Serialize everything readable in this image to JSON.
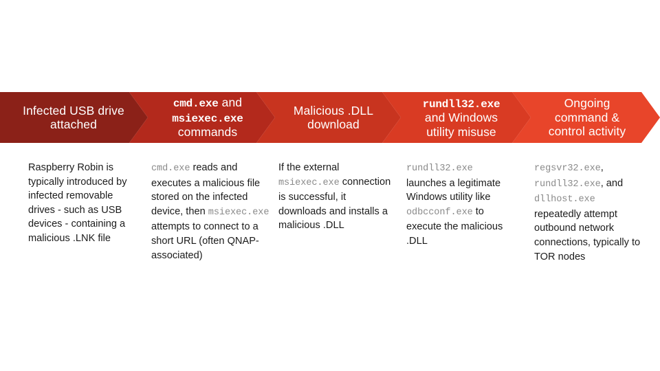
{
  "banner": {
    "aria": "Raspberry Robin attack chain",
    "segments": [
      {
        "id": "infected-usb-drive-attached",
        "color": "#8B2118",
        "lines": [
          {
            "text": "Infected USB drive",
            "mono": false
          },
          {
            "text": "attached",
            "mono": false
          }
        ]
      },
      {
        "id": "cmd-exe-and-msiexec-exe-commands",
        "color": "#B3291C",
        "lines": [
          {
            "text": "cmd.exe",
            "mono": true,
            "suffix": " and"
          },
          {
            "text": "msiexec.exe",
            "mono": true
          },
          {
            "text": "commands",
            "mono": false
          }
        ]
      },
      {
        "id": "malicious-dll-download",
        "color": "#C8341F",
        "lines": [
          {
            "text": "Malicious .DLL",
            "mono": false
          },
          {
            "text": "download",
            "mono": false
          }
        ]
      },
      {
        "id": "rundll32-exe-and-windows-utility-misuse",
        "color": "#D93B23",
        "lines": [
          {
            "text": "rundll32.exe",
            "mono": true
          },
          {
            "text": "and Windows",
            "mono": false
          },
          {
            "text": "utility misuse",
            "mono": false
          }
        ]
      },
      {
        "id": "ongoing-command-and-control-activity",
        "color": "#E8452A",
        "lines": [
          {
            "text": "Ongoing",
            "mono": false
          },
          {
            "text": "command &",
            "mono": false
          },
          {
            "text": "control activity",
            "mono": false
          }
        ]
      }
    ]
  },
  "columns": [
    {
      "id": "stage-1-description",
      "runs": [
        {
          "text": "Raspberry Robin is typically introduced by infected removable drives - such as USB devices - containing a malicious .LNK file",
          "mono": false
        }
      ]
    },
    {
      "id": "stage-2-description",
      "runs": [
        {
          "text": "cmd.exe",
          "mono": true
        },
        {
          "text": " reads and executes a malicious file stored on the infected device, then ",
          "mono": false
        },
        {
          "text": "msiexec.exe",
          "mono": true
        },
        {
          "text": " attempts to connect to a short URL (often QNAP-associated)",
          "mono": false
        }
      ]
    },
    {
      "id": "stage-3-description",
      "runs": [
        {
          "text": "If the external ",
          "mono": false
        },
        {
          "text": "msiexec.exe",
          "mono": true
        },
        {
          "text": " connection is successful, it downloads and installs a malicious .DLL",
          "mono": false
        }
      ]
    },
    {
      "id": "stage-4-description",
      "runs": [
        {
          "text": "rundll32.exe",
          "mono": true
        },
        {
          "text": " launches a legitimate Windows utility like ",
          "mono": false
        },
        {
          "text": "odbcconf.exe",
          "mono": true
        },
        {
          "text": " to execute the malicious .DLL",
          "mono": false
        }
      ]
    },
    {
      "id": "stage-5-description",
      "runs": [
        {
          "text": "regsvr32.exe",
          "mono": true
        },
        {
          "text": ", ",
          "mono": false
        },
        {
          "text": "rundll32.exe",
          "mono": true
        },
        {
          "text": ", and ",
          "mono": false
        },
        {
          "text": "dllhost.exe",
          "mono": true
        },
        {
          "text": " repeatedly attempt outbound network connections, typically to TOR nodes",
          "mono": false
        }
      ]
    }
  ],
  "theme": {
    "background": "#ffffff",
    "body_text_color": "#1b1b1b",
    "mono_text_color": "#8a8a8a",
    "banner_text_color": "#ffffff"
  }
}
